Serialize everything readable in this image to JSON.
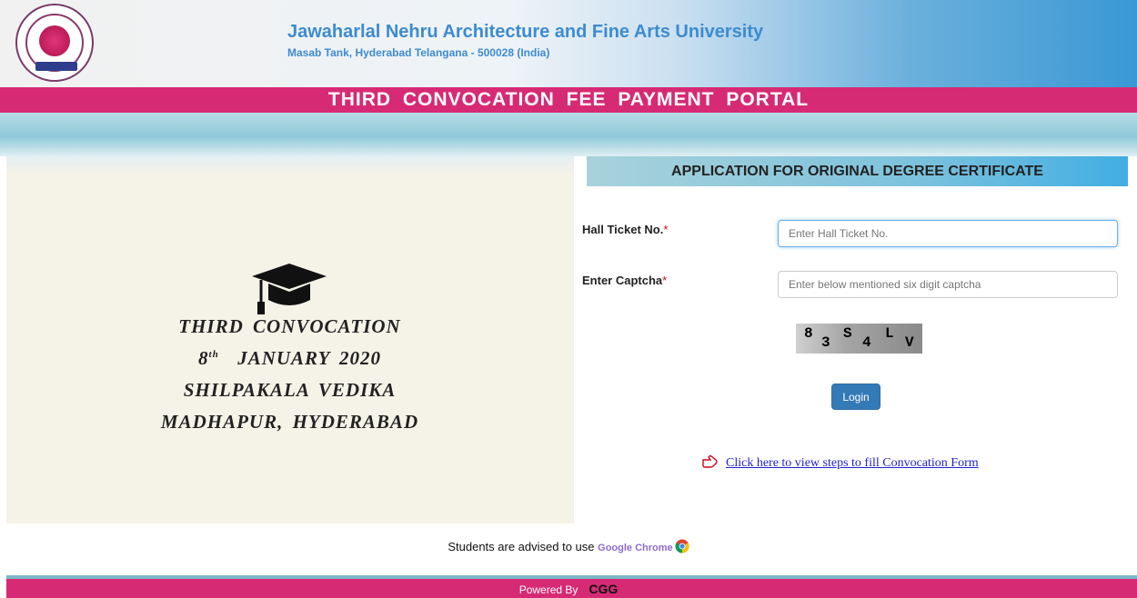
{
  "header": {
    "university_name": "Jawaharlal Nehru Architecture and Fine Arts University",
    "address": "Masab Tank, Hyderabad Telangana - 500028 (India)",
    "logo_icon": "university-seal-icon"
  },
  "portal_title": "THIRD  CONVOCATION  FEE  PAYMENT  PORTAL",
  "event": {
    "icon": "graduation-cap-icon",
    "line1": "THIRD  CONVOCATION",
    "day": "8",
    "day_suffix": "th",
    "date_rest": "JANUARY  2020",
    "venue": "SHILPAKALA  VEDIKA",
    "city": "MADHAPUR,  HYDERABAD"
  },
  "form": {
    "heading": "APPLICATION FOR ORIGINAL DEGREE CERTIFICATE",
    "hall_ticket_label": "Hall Ticket No.",
    "hall_ticket_placeholder": "Enter Hall Ticket No.",
    "captcha_label": "Enter Captcha",
    "captcha_placeholder": "Enter below mentioned six digit captcha",
    "required_mark": "*",
    "captcha_chars": [
      "8",
      "3",
      "S",
      "4",
      "L",
      "V"
    ],
    "login_label": "Login",
    "steps_link": "Click here to view steps to fill Convocation Form"
  },
  "advisory": {
    "text": "Students are advised to use",
    "browser": "Google Chrome"
  },
  "footer": {
    "powered_by": "Powered By",
    "vendor": "CGG"
  },
  "colors": {
    "accent_pink": "#d62a75",
    "title_blue": "#3d8bd0",
    "button_blue": "#337ab7",
    "panel_beige": "#f5f2e8"
  }
}
